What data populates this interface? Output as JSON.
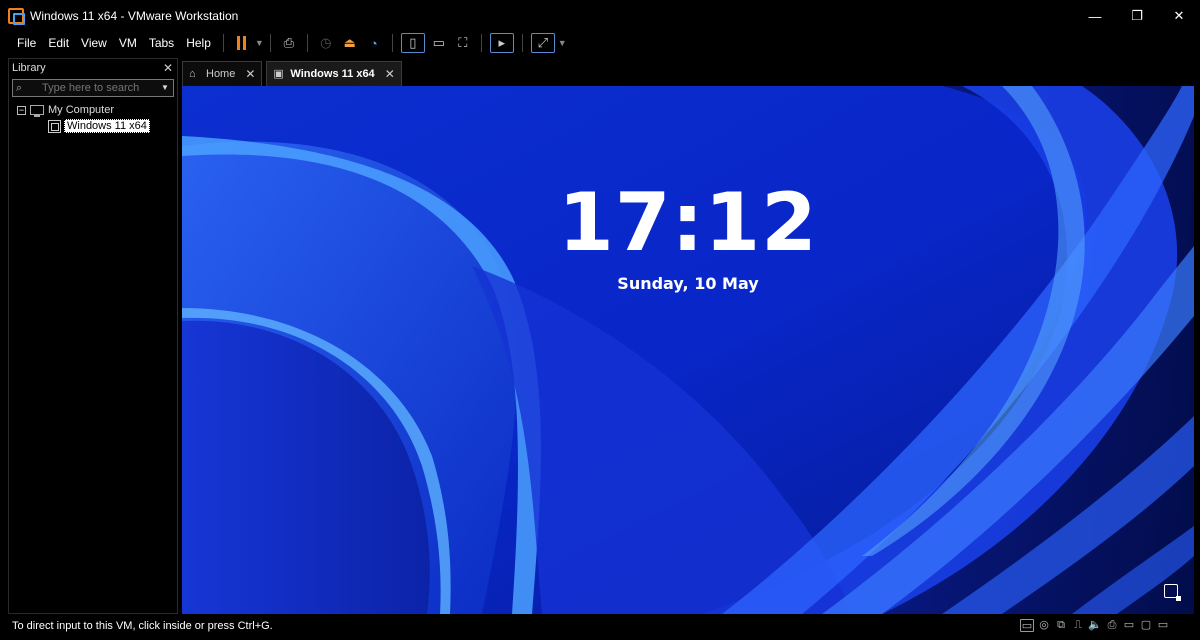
{
  "window": {
    "title": "Windows 11 x64 - VMware Workstation",
    "controls": {
      "minimize": "—",
      "maximize": "❐",
      "close": "✕"
    }
  },
  "menu": {
    "items": [
      "File",
      "Edit",
      "View",
      "VM",
      "Tabs",
      "Help"
    ]
  },
  "toolbar": {
    "icons": [
      "pause-icon",
      "send-ctrl-alt-del-icon",
      "snapshot-icon",
      "revert-snapshot-icon",
      "snapshot-manager-icon",
      "show-library-icon",
      "show-thumbnail-icon",
      "full-screen-icon",
      "console-icon",
      "stretch-icon"
    ]
  },
  "library": {
    "title": "Library",
    "close": "✕",
    "search_placeholder": "Type here to search",
    "tree": {
      "root": {
        "expander": "−",
        "label": "My Computer"
      },
      "child": {
        "label": "Windows 11 x64"
      }
    }
  },
  "tabs": [
    {
      "label": "Home",
      "icon": "home-icon",
      "close": "✕",
      "active": false
    },
    {
      "label": "Windows 11 x64",
      "icon": "vm-icon",
      "close": "✕",
      "active": true
    }
  ],
  "vm_screen": {
    "time": "17:12",
    "date": "Sunday, 10 May"
  },
  "status": {
    "message": "To direct input to this VM, click inside or press Ctrl+G."
  },
  "colors": {
    "accent_orange": "#f0801a",
    "accent_blue": "#4aa3f0",
    "wallpaper_blue": "#0a2bd8"
  }
}
